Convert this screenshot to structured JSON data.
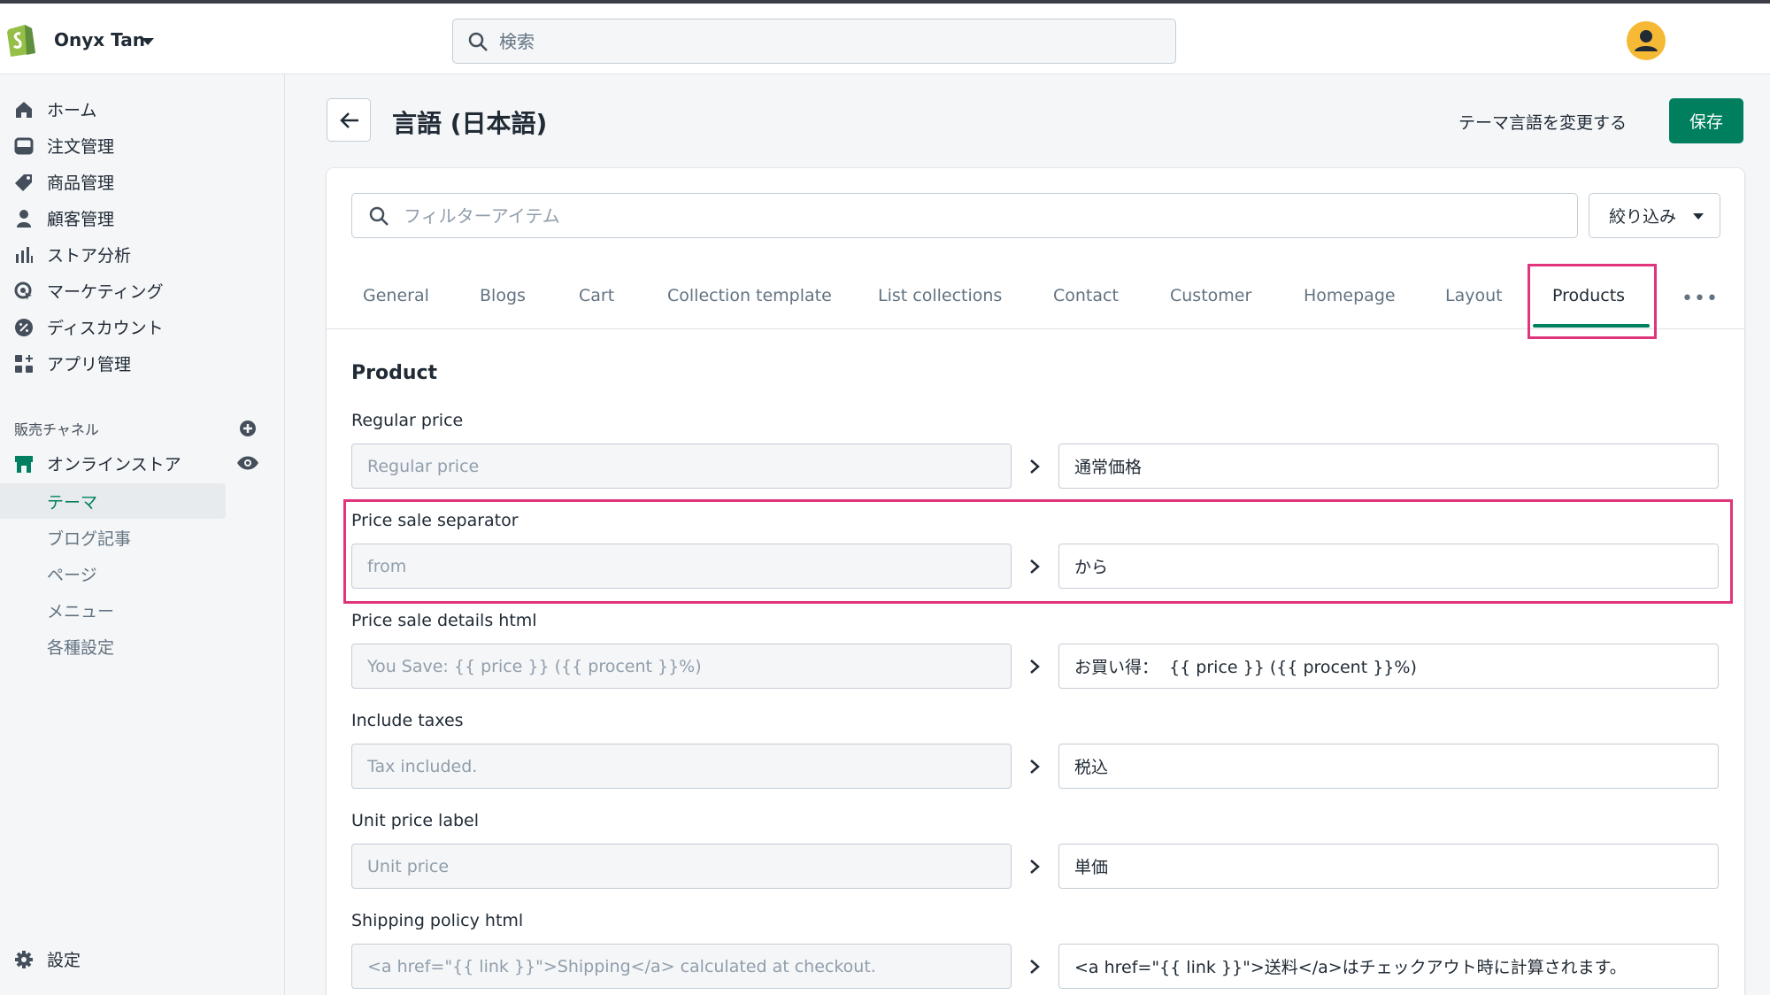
{
  "topbar": {
    "store_name": "Onyx Tan",
    "search_placeholder": "検索"
  },
  "sidebar": {
    "items": [
      {
        "label": "ホーム",
        "icon": "home-icon"
      },
      {
        "label": "注文管理",
        "icon": "orders-icon"
      },
      {
        "label": "商品管理",
        "icon": "tag-icon"
      },
      {
        "label": "顧客管理",
        "icon": "customer-icon"
      },
      {
        "label": "ストア分析",
        "icon": "analytics-icon"
      },
      {
        "label": "マーケティング",
        "icon": "marketing-icon"
      },
      {
        "label": "ディスカウント",
        "icon": "discount-icon"
      },
      {
        "label": "アプリ管理",
        "icon": "apps-icon"
      }
    ],
    "sales_channels_title": "販売チャネル",
    "online_store": "オンラインストア",
    "sub_items": [
      "テーマ",
      "ブログ記事",
      "ページ",
      "メニュー",
      "各種設定"
    ],
    "settings": "設定"
  },
  "header": {
    "title": "言語 (日本語)",
    "change_language": "テーマ言語を変更する",
    "save": "保存"
  },
  "filter": {
    "placeholder": "フィルターアイテム",
    "narrow": "絞り込み"
  },
  "tabs": [
    "General",
    "Blogs",
    "Cart",
    "Collection template",
    "List collections",
    "Contact",
    "Customer",
    "Homepage",
    "Layout",
    "Products"
  ],
  "active_tab": "Products",
  "section": {
    "heading": "Product",
    "fields": [
      {
        "label": "Regular price",
        "source": "Regular price",
        "translation": "通常価格"
      },
      {
        "label": "Price sale separator",
        "source": "from",
        "translation": "から"
      },
      {
        "label": "Price sale details html",
        "source": "You Save: {{ price }} ({{ procent }}%)",
        "translation": "お買い得：  {{ price }} ({{ procent }}%)"
      },
      {
        "label": "Include taxes",
        "source": "Tax included.",
        "translation": "税込"
      },
      {
        "label": "Unit price label",
        "source": "Unit price",
        "translation": "単価"
      },
      {
        "label": "Shipping policy html",
        "source": "<a href=\"{{ link }}\">Shipping</a> calculated at checkout.",
        "translation": "<a href=\"{{ link }}\">送料</a>はチェックアウト時に計算されます。"
      }
    ]
  },
  "colors": {
    "accent": "#008060",
    "highlight": "#e0357a"
  }
}
